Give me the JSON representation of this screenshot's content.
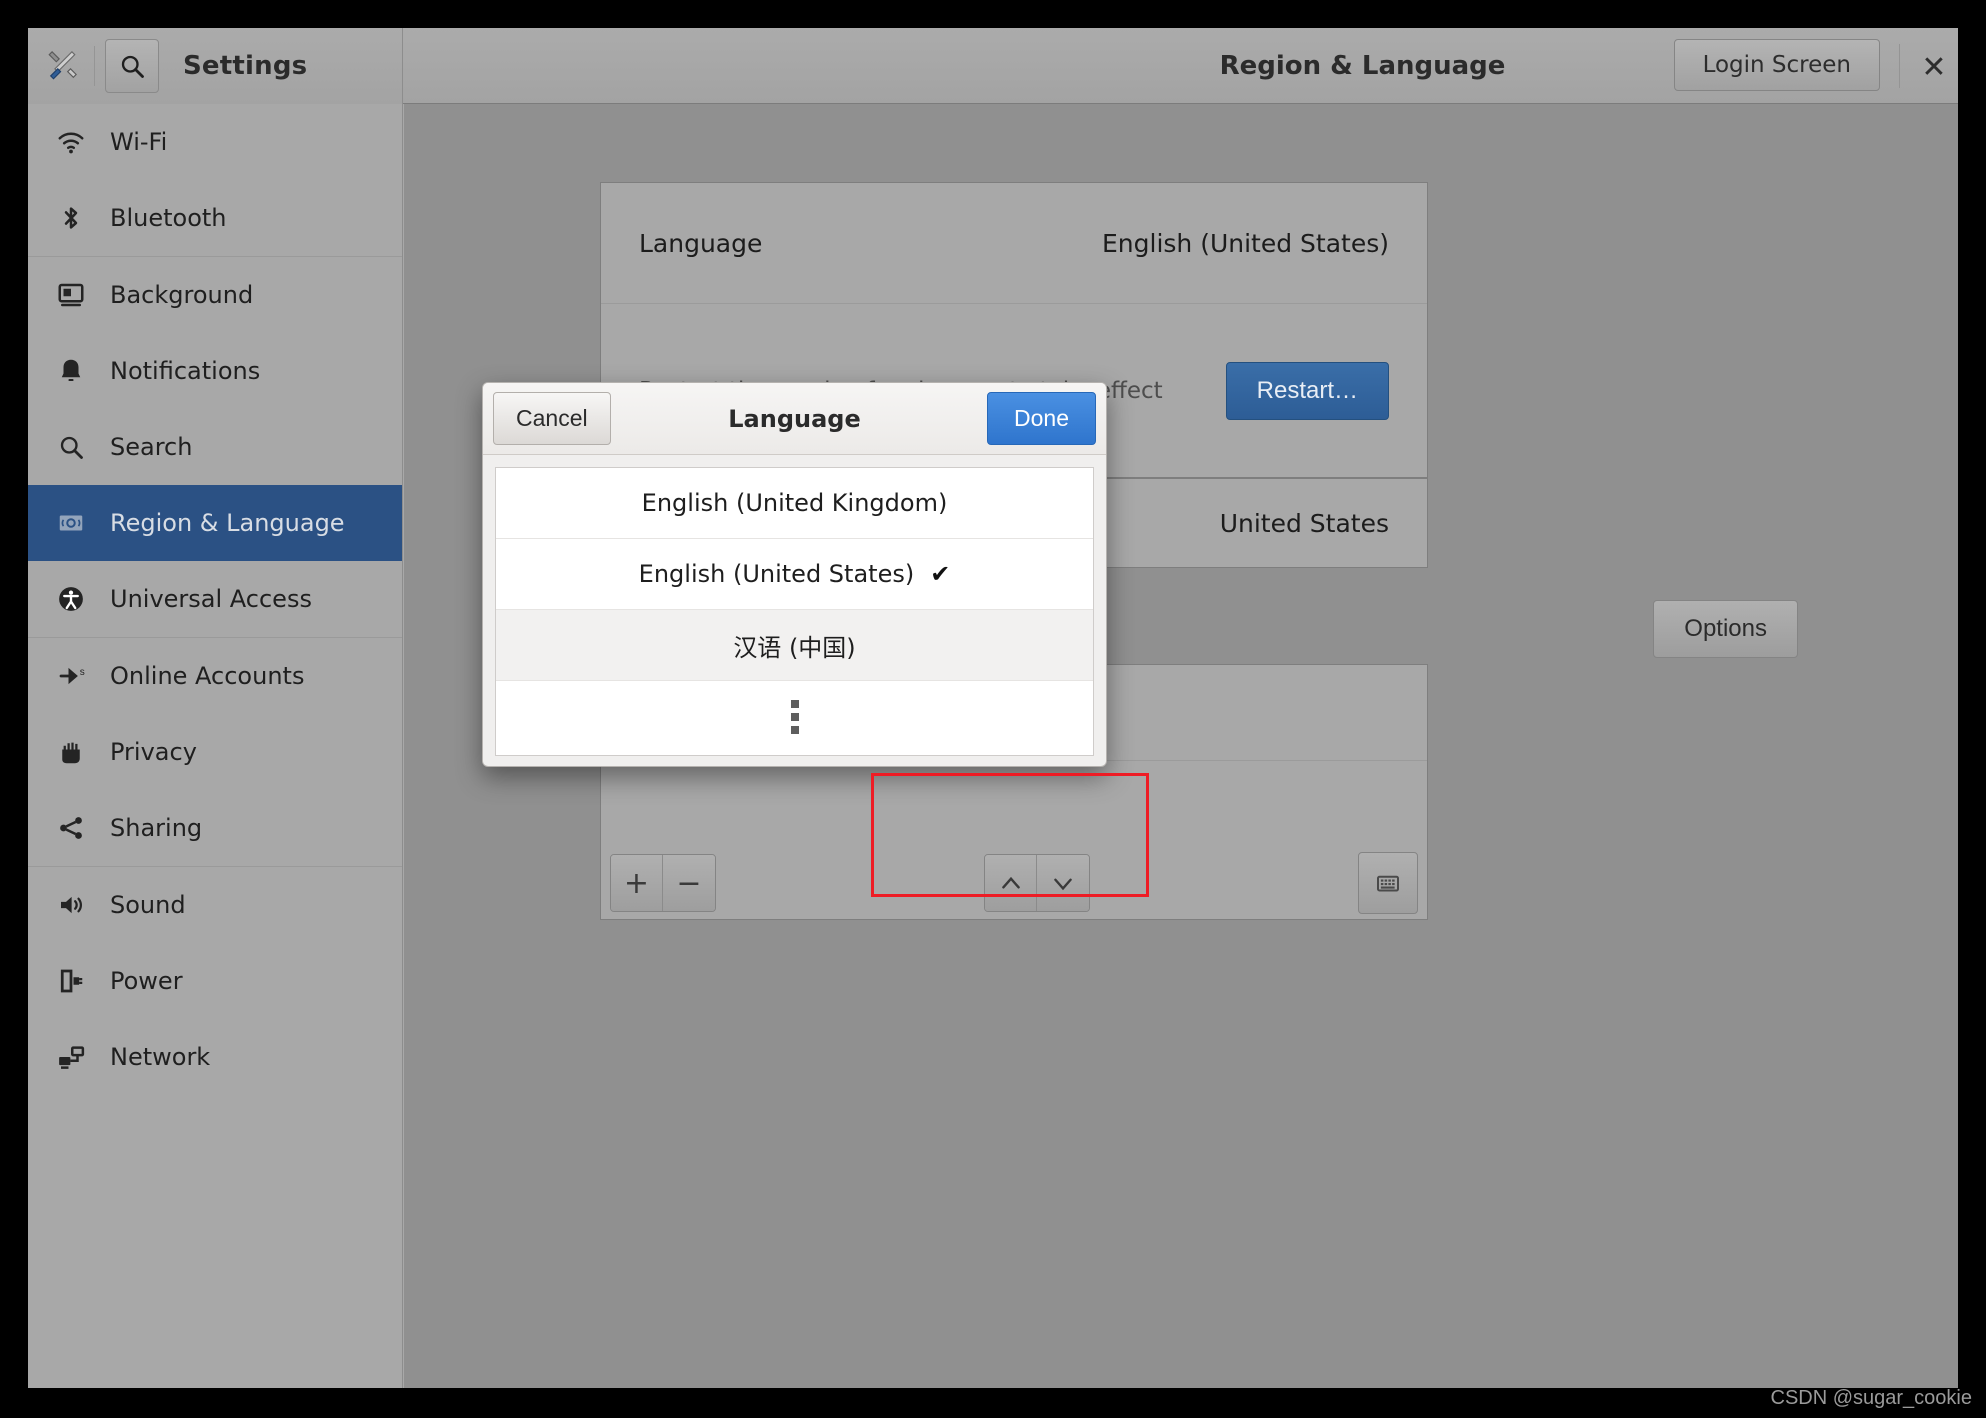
{
  "window": {
    "app_title": "Settings",
    "page_title": "Region & Language",
    "login_screen_label": "Login Screen",
    "close_label": "✕",
    "tools_icon": "tools-icon",
    "search_icon": "search-icon"
  },
  "sidebar": {
    "items": [
      {
        "label": "Wi-Fi",
        "icon": "wifi-icon",
        "selected": false
      },
      {
        "label": "Bluetooth",
        "icon": "bluetooth-icon",
        "selected": false
      },
      {
        "label": "Background",
        "icon": "background-icon",
        "selected": false
      },
      {
        "label": "Notifications",
        "icon": "bell-icon",
        "selected": false
      },
      {
        "label": "Search",
        "icon": "search-icon",
        "selected": false
      },
      {
        "label": "Region & Language",
        "icon": "region-language-icon",
        "selected": true
      },
      {
        "label": "Universal Access",
        "icon": "universal-access-icon",
        "selected": false
      },
      {
        "label": "Online Accounts",
        "icon": "online-accounts-icon",
        "selected": false
      },
      {
        "label": "Privacy",
        "icon": "privacy-hand-icon",
        "selected": false
      },
      {
        "label": "Sharing",
        "icon": "sharing-icon",
        "selected": false
      },
      {
        "label": "Sound",
        "icon": "sound-icon",
        "selected": false
      },
      {
        "label": "Power",
        "icon": "power-icon",
        "selected": false
      },
      {
        "label": "Network",
        "icon": "network-icon",
        "selected": false
      }
    ]
  },
  "content": {
    "language_label": "Language",
    "language_value": "English (United States)",
    "restart_note": "Restart the session for changes to take effect",
    "restart_button": "Restart…",
    "formats_value": "United States",
    "options_button": "Options",
    "toolbar": {
      "add": "+",
      "remove": "−",
      "move_up": "⌃",
      "move_down": "⌄",
      "keyboard_icon": "keyboard-icon"
    }
  },
  "dialog": {
    "title": "Language",
    "cancel_label": "Cancel",
    "done_label": "Done",
    "check_glyph": "✔",
    "languages": [
      {
        "label": "English (United Kingdom)",
        "checked": false,
        "hovered": false
      },
      {
        "label": "English (United States)",
        "checked": true,
        "hovered": false
      },
      {
        "label": "汉语 (中国)",
        "checked": false,
        "hovered": true
      }
    ],
    "more_indicator": "more-languages-ellipsis"
  },
  "annotation": {
    "color": "#ee1c25",
    "target": "汉语 (中国)"
  },
  "watermark": "CSDN @sugar_cookie",
  "colors": {
    "selected_sidebar": "#2b5184",
    "restart_button": "#2d5d96",
    "done_button": "#2f75cd",
    "annotation_red": "#ee1c25",
    "window_bg": "#a8a8a8",
    "content_bg": "#909090"
  }
}
